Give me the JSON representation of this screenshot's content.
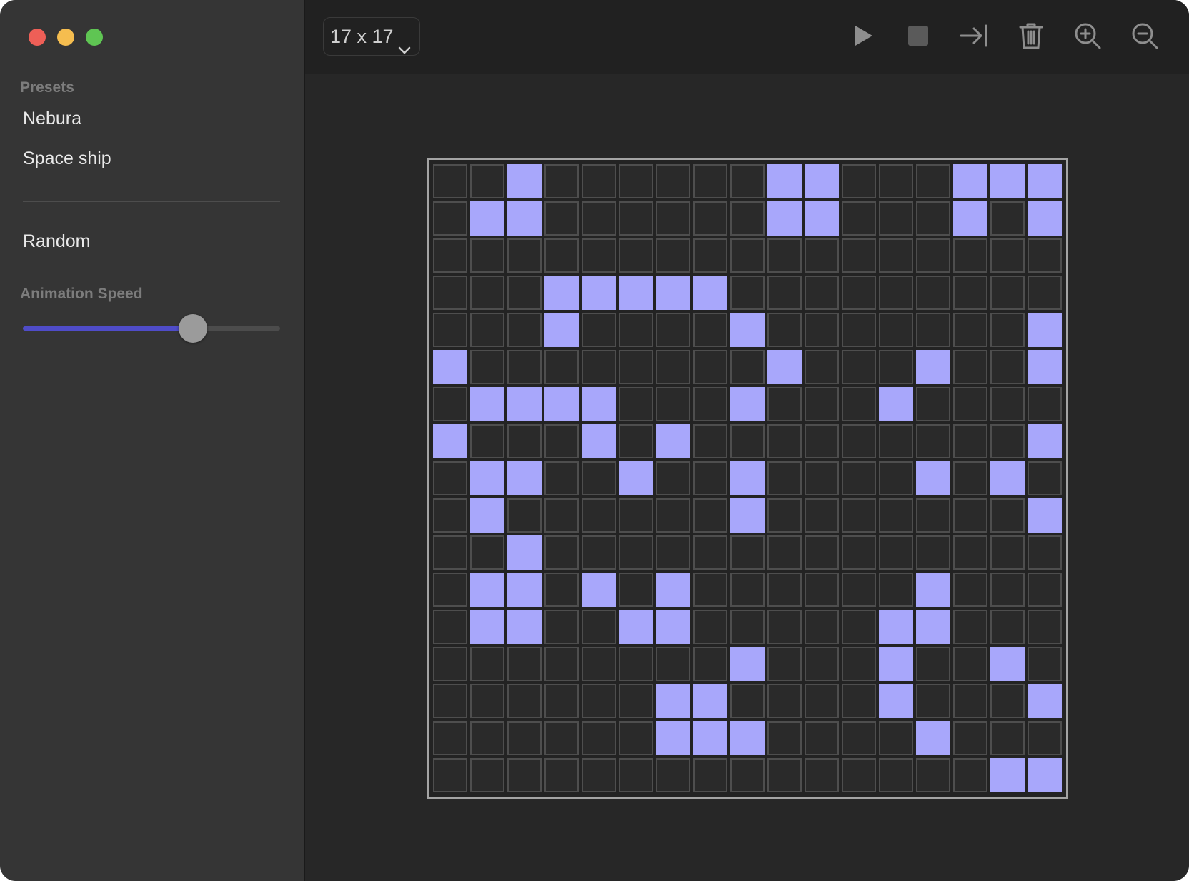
{
  "window": {
    "buttons": [
      "close",
      "minimize",
      "zoom"
    ]
  },
  "sidebar": {
    "presets_label": "Presets",
    "presets": [
      "Nebura",
      "Space ship"
    ],
    "random_label": "Random",
    "speed_label": "Animation Speed",
    "speed_value": 0.66
  },
  "toolbar": {
    "grid_size": "17 x 17",
    "icons": [
      "play-icon",
      "stop-icon",
      "step-forward-icon",
      "trash-icon",
      "zoom-in-icon",
      "zoom-out-icon"
    ]
  },
  "colors": {
    "alive": "#a8a7fb",
    "dead": "#2a2a2a",
    "accent": "#4f4cc8"
  },
  "grid": {
    "size": 17,
    "rows": [
      "00100000011000111",
      "01100000011000101",
      "00000000000000000",
      "00011111000000000",
      "00010000100000001",
      "10000000010001001",
      "01111000100010000",
      "10001010000000001",
      "01100100100001010",
      "01000000100000001",
      "00100000000000000",
      "01101010000001000",
      "01100110000011000",
      "00000000100010010",
      "00000011000010001",
      "00000011100001000",
      "00000000000000011"
    ]
  }
}
